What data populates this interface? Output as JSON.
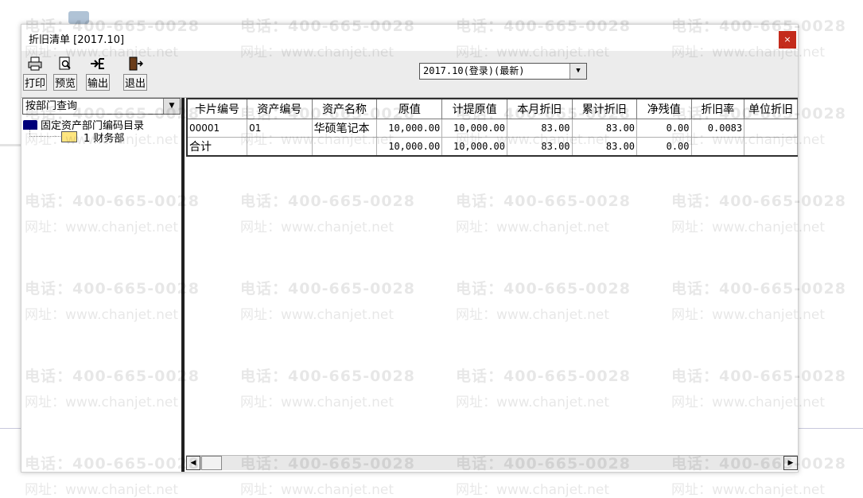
{
  "window": {
    "title": "折旧清单 [2017.10]",
    "close_glyph": "×"
  },
  "toolbar": {
    "buttons": [
      {
        "label": "打印",
        "icon": "printer-icon"
      },
      {
        "label": "预览",
        "icon": "preview-icon"
      },
      {
        "label": "输出",
        "icon": "export-icon"
      },
      {
        "label": "退出",
        "icon": "exit-door-icon"
      }
    ],
    "period": "2017.10(登录)(最新)"
  },
  "left_pane": {
    "query_mode": "按部门查询",
    "tree": {
      "root": "固定资产部门编码目录",
      "children": [
        "1 财务部"
      ]
    }
  },
  "table": {
    "columns": [
      "卡片编号",
      "资产编号",
      "资产名称",
      "原值",
      "计提原值",
      "本月折旧",
      "累计折旧",
      "净残值",
      "折旧率",
      "单位折旧"
    ],
    "rows": [
      [
        "00001",
        "01",
        "华硕笔记本",
        "10,000.00",
        "10,000.00",
        "83.00",
        "83.00",
        "0.00",
        "0.0083",
        ""
      ],
      [
        "合计",
        "",
        "",
        "10,000.00",
        "10,000.00",
        "83.00",
        "83.00",
        "0.00",
        "",
        ""
      ]
    ]
  },
  "watermark": {
    "phone": "电话：400-665-0028",
    "site": "网址：www.chanjet.net"
  }
}
